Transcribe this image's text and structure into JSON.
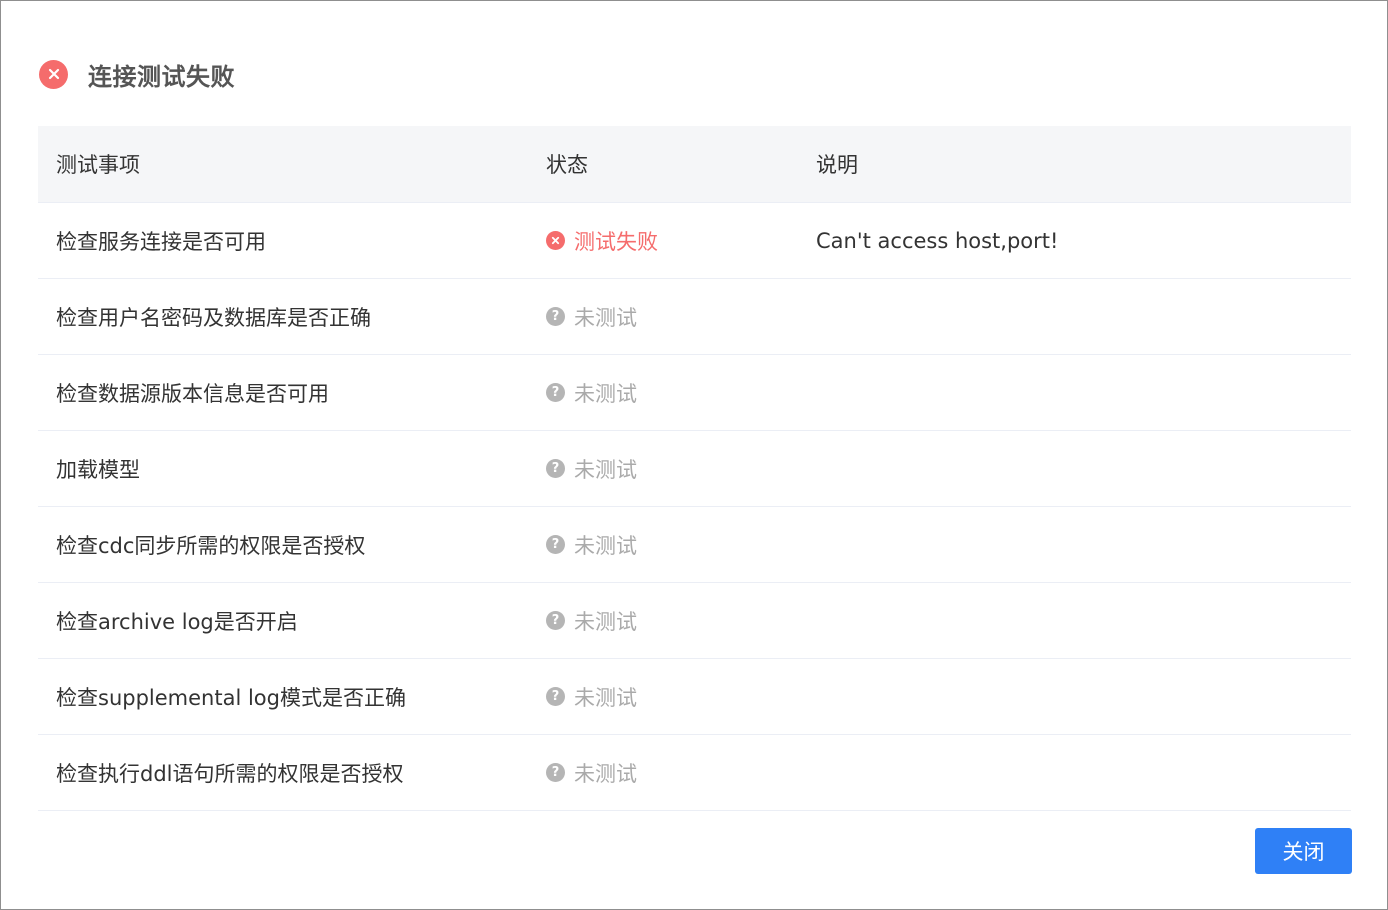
{
  "dialog": {
    "title": "连接测试失败",
    "close_label": "关闭"
  },
  "table": {
    "headers": {
      "item": "测试事项",
      "status": "状态",
      "desc": "说明"
    },
    "rows": [
      {
        "item": "检查服务连接是否可用",
        "status": "测试失败",
        "status_type": "fail",
        "desc": "Can't access host,port!"
      },
      {
        "item": "检查用户名密码及数据库是否正确",
        "status": "未测试",
        "status_type": "untested",
        "desc": ""
      },
      {
        "item": "检查数据源版本信息是否可用",
        "status": "未测试",
        "status_type": "untested",
        "desc": ""
      },
      {
        "item": "加载模型",
        "status": "未测试",
        "status_type": "untested",
        "desc": ""
      },
      {
        "item": "检查cdc同步所需的权限是否授权",
        "status": "未测试",
        "status_type": "untested",
        "desc": ""
      },
      {
        "item": "检查archive log是否开启",
        "status": "未测试",
        "status_type": "untested",
        "desc": ""
      },
      {
        "item": "检查supplemental log模式是否正确",
        "status": "未测试",
        "status_type": "untested",
        "desc": ""
      },
      {
        "item": "检查执行ddl语句所需的权限是否授权",
        "status": "未测试",
        "status_type": "untested",
        "desc": ""
      }
    ]
  },
  "colors": {
    "error": "#f56c6c",
    "untested": "#aaaaaa",
    "primary": "#2f80f6",
    "header_bg": "#f5f6f8"
  },
  "icons": {
    "title": "error-circle-icon",
    "fail": "error-circle-icon",
    "untested": "question-circle-icon"
  }
}
